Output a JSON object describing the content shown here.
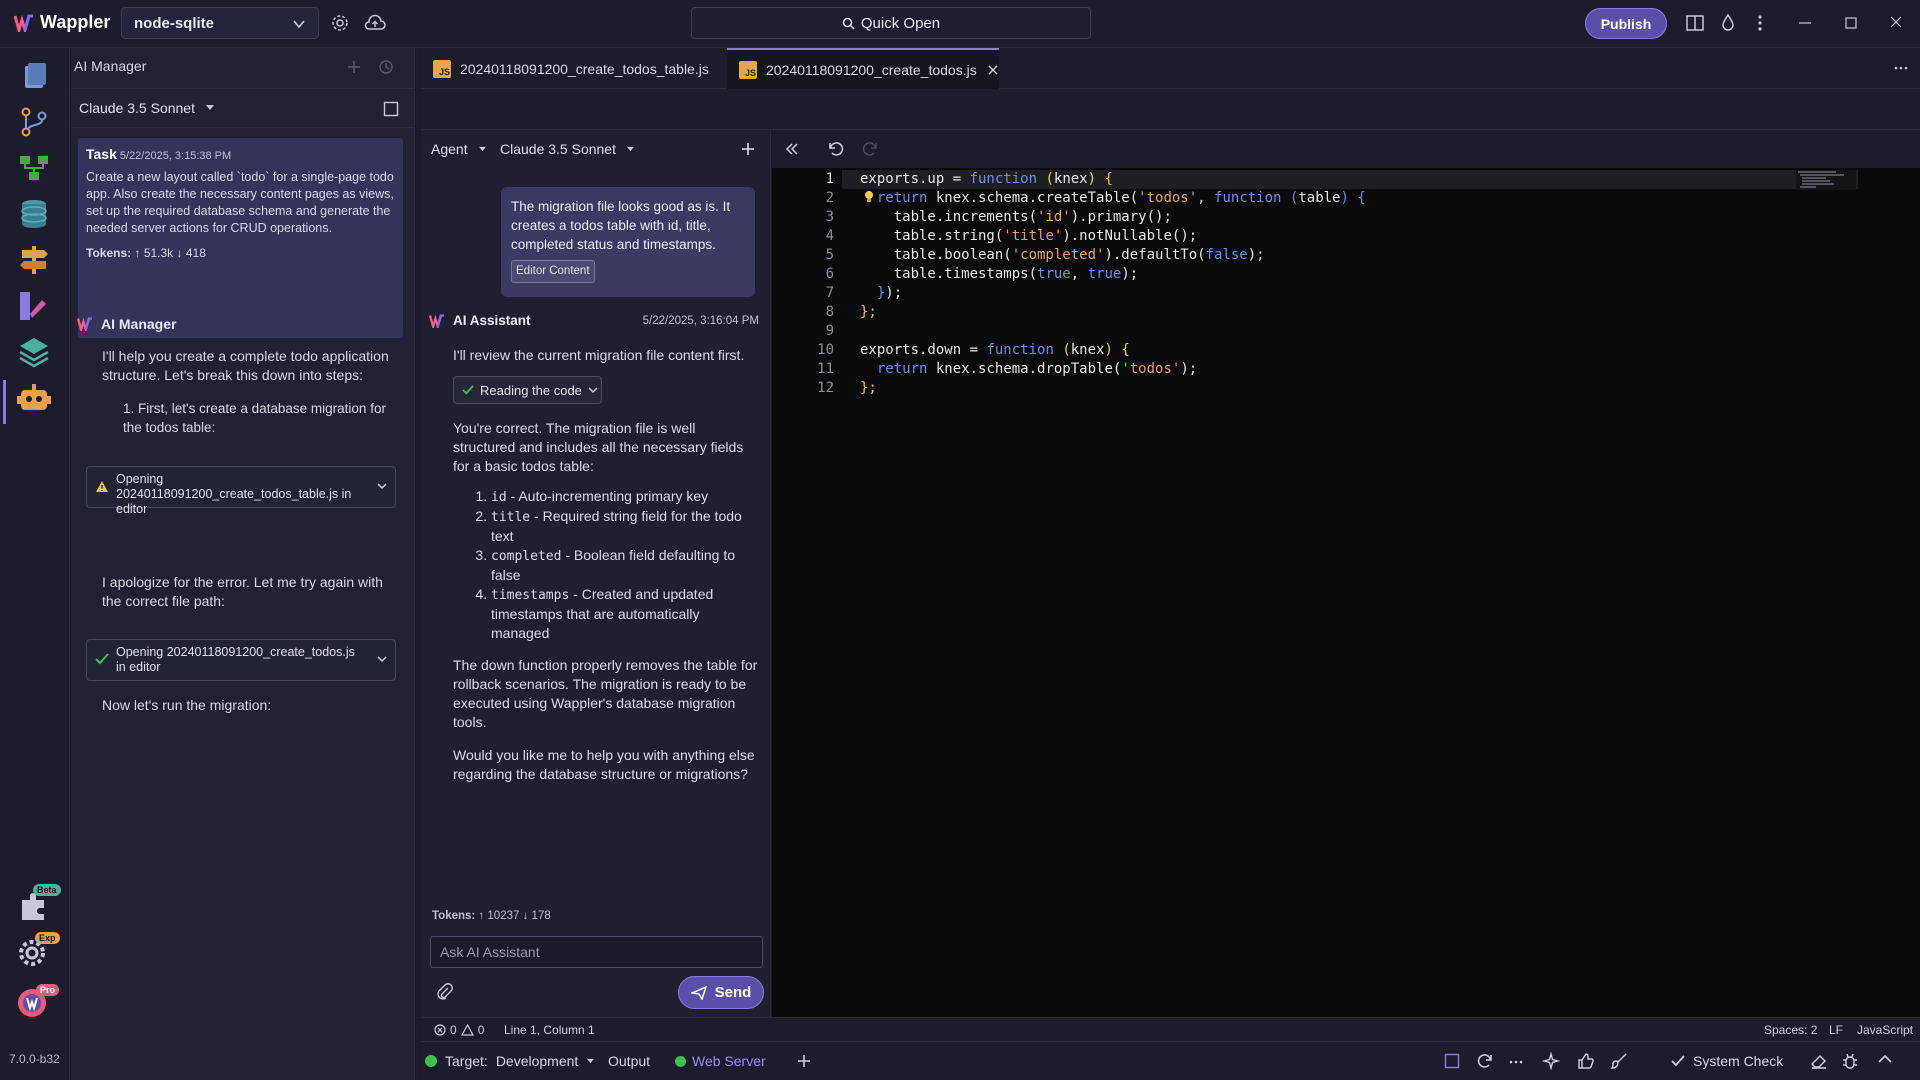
{
  "app": {
    "name": "Wappler",
    "version": "7.0.0-b32"
  },
  "titlebar": {
    "project": "node-sqlite",
    "quick_open": "Quick Open",
    "publish": "Publish"
  },
  "activity": {
    "badge_beta": "Beta",
    "badge_exp": "Exp",
    "badge_pro": "Pro"
  },
  "ai_panel": {
    "title": "AI Manager",
    "model": "Claude 3.5 Sonnet",
    "task": {
      "label": "Task",
      "time": "5/22/2025, 3:15:38 PM",
      "text": "Create a new layout called `todo` for a single-page todo app. Also create the necessary content pages as views, set up the required database schema and generate the needed server actions for CRUD operations.",
      "tokens_label": "Tokens:",
      "tokens_up": "51.3k",
      "tokens_down": "418"
    },
    "manager_name": "AI Manager",
    "msg1": "I'll help you create a complete todo application structure. Let's break this down into steps:",
    "step1": "1. First, let's create a database migration for the todos table:",
    "op1": "Opening 20240118091200_create_todos_table.js in editor",
    "msg2": "I apologize for the error. Let me try again with the correct file path:",
    "op2": "Opening 20240118091200_create_todos.js in editor",
    "msg3": "Now let's run the migration:"
  },
  "tabs": [
    {
      "label": "20240118091200_create_todos_table.js",
      "badge": "JS"
    },
    {
      "label": "20240118091200_create_todos.js",
      "badge": "JS"
    }
  ],
  "chat": {
    "mode": "Agent",
    "model": "Claude 3.5 Sonnet",
    "user_msg": "The migration file looks good as is. It creates a todos table with id, title, completed status and timestamps.",
    "editor_content_btn": "Editor Content",
    "assistant_name": "AI Assistant",
    "assistant_time": "5/22/2025, 3:16:04 PM",
    "p1": "I'll review the current migration file content first.",
    "reading": "Reading the code",
    "p2": "You're correct. The migration file is well structured and includes all the necessary fields for a basic todos table:",
    "list": [
      {
        "code": "id",
        "text": " - Auto-incrementing primary key"
      },
      {
        "code": "title",
        "text": " - Required string field for the todo text"
      },
      {
        "code": "completed",
        "text": " - Boolean field defaulting to false"
      },
      {
        "code": "timestamps",
        "text": " - Created and updated timestamps that are automatically managed"
      }
    ],
    "p3": "The down function properly removes the table for rollback scenarios. The migration is ready to be executed using Wappler's database migration tools.",
    "p4": "Would you like me to help you with anything else regarding the database structure or migrations?",
    "tokens_label": "Tokens:",
    "tokens_up": "10237",
    "tokens_down": "178",
    "ask_placeholder": "Ask AI Assistant",
    "send": "Send"
  },
  "editor": {
    "lines": [
      "1",
      "2",
      "3",
      "4",
      "5",
      "6",
      "7",
      "8",
      "9",
      "10",
      "11",
      "12"
    ]
  },
  "status": {
    "errors": "0",
    "warnings": "0",
    "position": "Line 1, Column 1",
    "spaces": "Spaces: 2",
    "eol": "LF",
    "language": "JavaScript"
  },
  "bottom": {
    "target_label": "Target:",
    "target": "Development",
    "output": "Output",
    "web_server": "Web Server",
    "system_check": "System Check"
  },
  "colors": {
    "accent": "#8a7ce0",
    "publish_bg": "#5a4fa8",
    "green": "#3cc24a",
    "string": "#e8a45a",
    "keyword": "#6b8fe8"
  }
}
